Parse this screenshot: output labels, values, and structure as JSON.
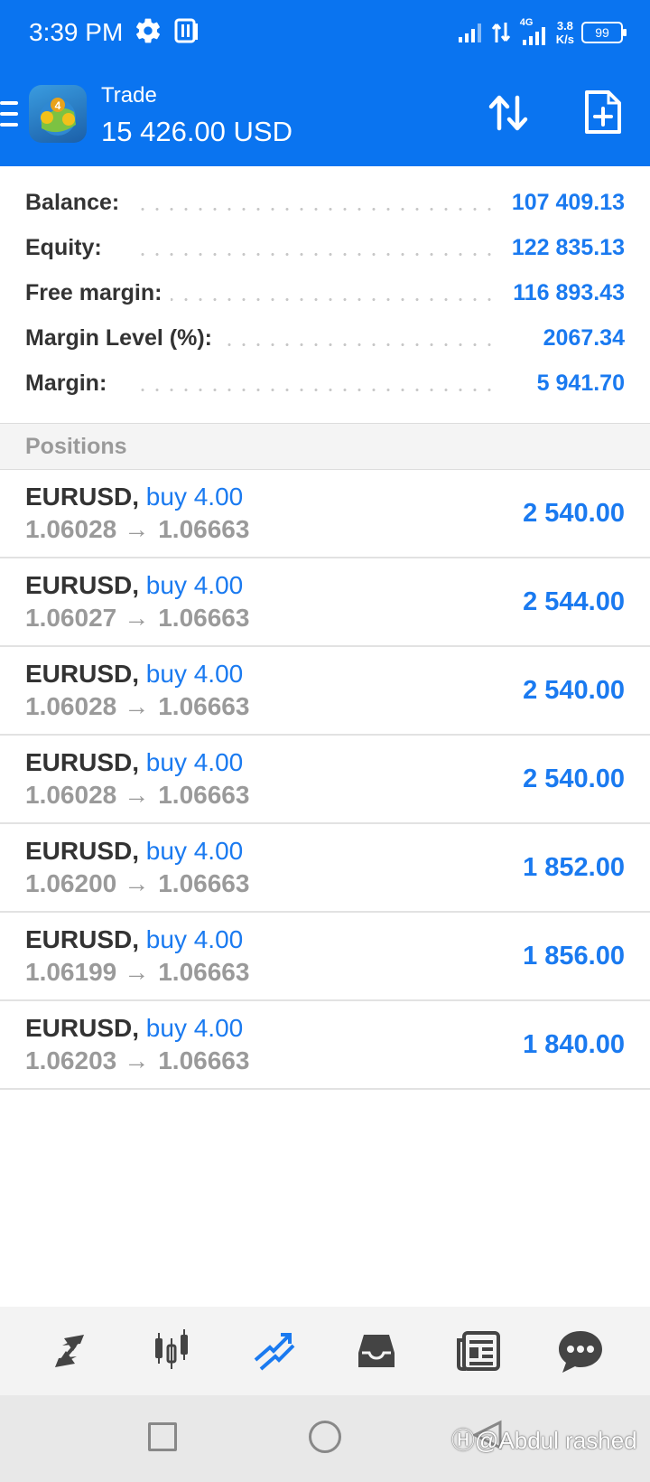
{
  "status_bar": {
    "time": "3:39 PM",
    "network": "4G",
    "speed_value": "3.8",
    "speed_unit": "K/s",
    "battery": "99",
    "icons": [
      "gear-icon",
      "app-notification-icon",
      "signal-icon",
      "data-transfer-icon",
      "signal-4g-icon",
      "battery-icon"
    ]
  },
  "header": {
    "title": "Trade",
    "amount": "15 426.00 USD",
    "icons": [
      "menu-icon",
      "metatrader-logo",
      "sort-icon",
      "new-order-icon"
    ]
  },
  "summary": [
    {
      "label": "Balance:",
      "value": "107 409.13"
    },
    {
      "label": "Equity:",
      "value": "122 835.13"
    },
    {
      "label": "Free margin:",
      "value": "116 893.43"
    },
    {
      "label": "Margin Level (%):",
      "value": "2067.34"
    },
    {
      "label": "Margin:",
      "value": "5 941.70"
    }
  ],
  "positions_title": "Positions",
  "positions": [
    {
      "symbol": "EURUSD,",
      "type": "buy 4.00",
      "open": "1.06028",
      "arrow": "→",
      "current": "1.06663",
      "profit": "2 540.00"
    },
    {
      "symbol": "EURUSD,",
      "type": "buy 4.00",
      "open": "1.06027",
      "arrow": "→",
      "current": "1.06663",
      "profit": "2 544.00"
    },
    {
      "symbol": "EURUSD,",
      "type": "buy 4.00",
      "open": "1.06028",
      "arrow": "→",
      "current": "1.06663",
      "profit": "2 540.00"
    },
    {
      "symbol": "EURUSD,",
      "type": "buy 4.00",
      "open": "1.06028",
      "arrow": "→",
      "current": "1.06663",
      "profit": "2 540.00"
    },
    {
      "symbol": "EURUSD,",
      "type": "buy 4.00",
      "open": "1.06200",
      "arrow": "→",
      "current": "1.06663",
      "profit": "1 852.00"
    },
    {
      "symbol": "EURUSD,",
      "type": "buy 4.00",
      "open": "1.06199",
      "arrow": "→",
      "current": "1.06663",
      "profit": "1 856.00"
    },
    {
      "symbol": "EURUSD,",
      "type": "buy 4.00",
      "open": "1.06203",
      "arrow": "→",
      "current": "1.06663",
      "profit": "1 840.00"
    }
  ],
  "bottom_nav": {
    "items": [
      "quotes-icon",
      "chart-icon",
      "trade-icon",
      "history-icon",
      "news-icon",
      "chat-icon"
    ],
    "active": "trade-icon"
  },
  "watermark": "Ⓗ@Abdul rashed",
  "colors": {
    "header_bg": "#0a74f0",
    "accent": "#1a7af0",
    "label": "#333333",
    "muted": "#9a9a9a"
  }
}
